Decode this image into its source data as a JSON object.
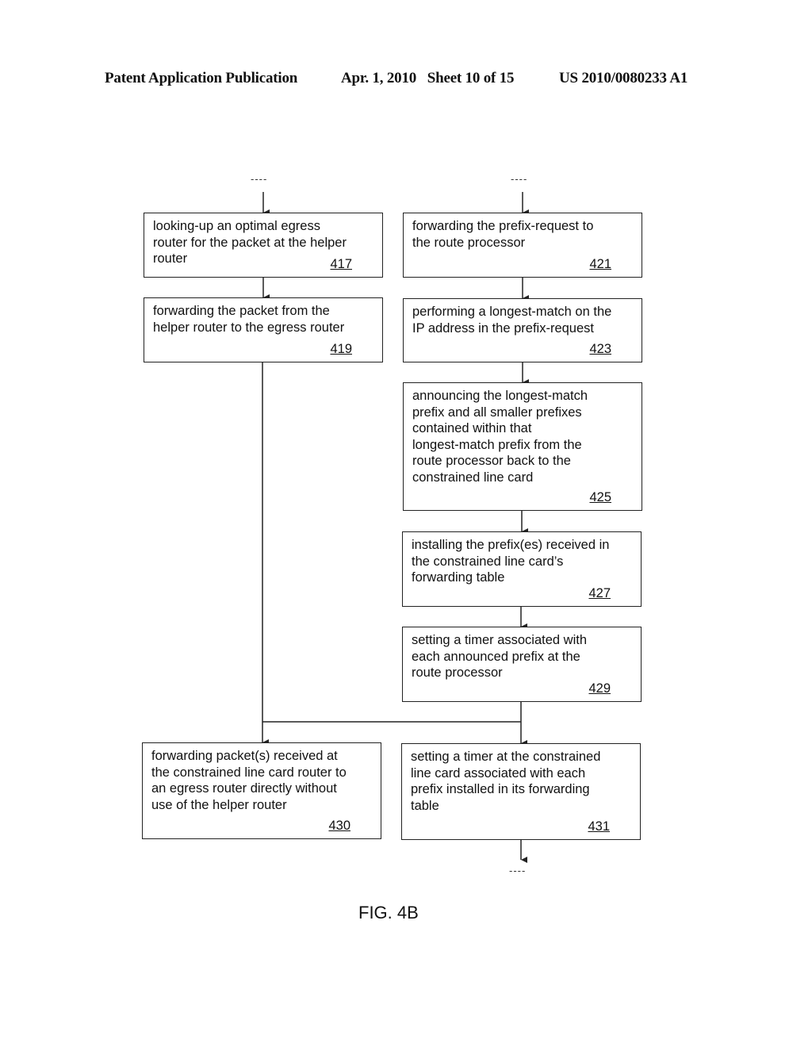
{
  "header": {
    "publication": "Patent Application Publication",
    "date_sheet": "Apr. 1, 2010   Sheet 10 of 15",
    "number": "US 2010/0080233 A1"
  },
  "continuation_marker": "----",
  "figure_label": "FIG. 4B",
  "steps": {
    "s417": {
      "text": "looking-up an optimal egress\nrouter for the packet at the helper\nrouter",
      "ref": "417"
    },
    "s419": {
      "text": "forwarding the packet from the\nhelper router to the egress router",
      "ref": "419"
    },
    "s421": {
      "text": "forwarding the prefix-request to\nthe route processor",
      "ref": "421"
    },
    "s423": {
      "text": "performing a longest-match on the\nIP address in the prefix-request",
      "ref": "423"
    },
    "s425": {
      "text": "announcing the longest-match\nprefix and all smaller prefixes\ncontained within that\nlongest-match prefix from the\nroute processor back to the\nconstrained line card",
      "ref": "425"
    },
    "s427": {
      "text": "installing the prefix(es) received in\nthe constrained line card’s\nforwarding table",
      "ref": "427"
    },
    "s429": {
      "text": "setting a timer associated with\neach announced prefix at the\nroute processor",
      "ref": "429"
    },
    "s430": {
      "text": "forwarding packet(s) received at\nthe constrained line card router to\nan egress router directly without\nuse of the helper router",
      "ref": "430"
    },
    "s431": {
      "text": "setting a timer at the constrained\nline card associated with each\nprefix installed in its forwarding\ntable",
      "ref": "431"
    }
  }
}
